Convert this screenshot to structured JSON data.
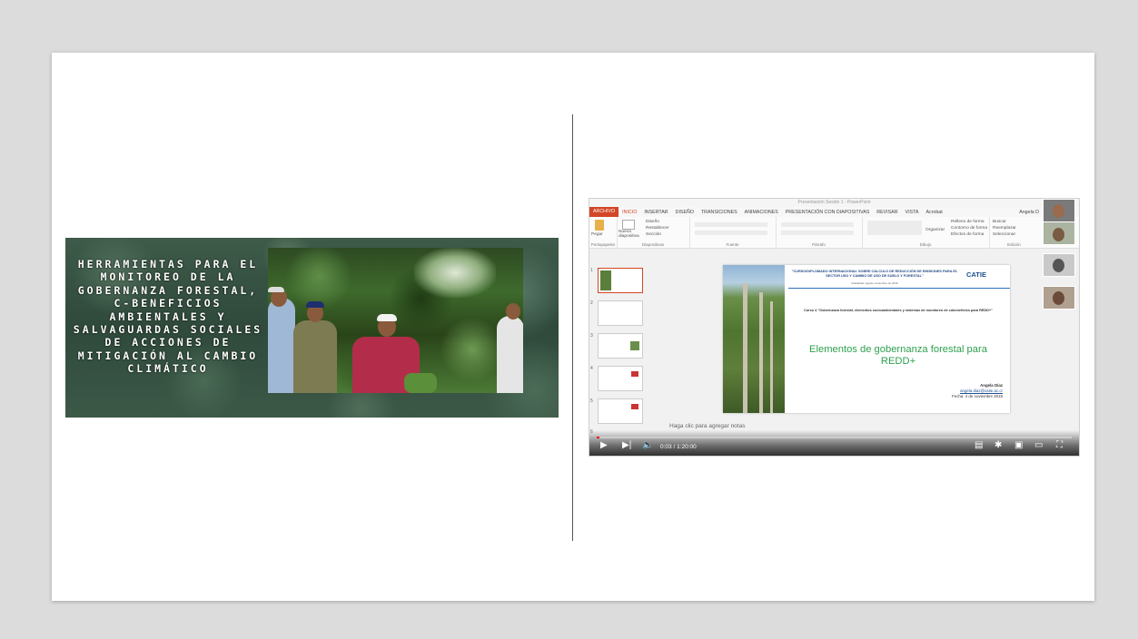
{
  "banner": {
    "text": "HERRAMIENTAS PARA EL MONITOREO DE LA GOBERNANZA FORESTAL, C-BENEFICIOS AMBIENTALES Y SALVAGUARDAS SOCIALES DE ACCIONES DE MITIGACIÓN AL CAMBIO CLIMÁTICO"
  },
  "ppt": {
    "window_title": "Presentación Sesión 1 - PowerPoint",
    "tabs": [
      "ARCHIVO",
      "INICIO",
      "INSERTAR",
      "DISEÑO",
      "TRANSICIONES",
      "ANIMACIONES",
      "PRESENTACIÓN CON DIAPOSITIVAS",
      "REVISAR",
      "VISTA",
      "Acrobat"
    ],
    "user": "Angela D",
    "ribbon": {
      "paste": "Pegar",
      "new_slide": "Nueva diapositiva",
      "layout": "Diseño",
      "reset": "Restablecer",
      "section": "Sección",
      "arrange": "Organizar",
      "quick_styles": "Estilos rápidos",
      "fill": "Relleno de forma",
      "outline": "Contorno de forma",
      "effects": "Efectos de forma",
      "find": "Buscar",
      "replace": "Reemplazar",
      "select": "Seleccionar",
      "group_clipboard": "Portapapeles",
      "group_slides": "Diapositivas",
      "group_font": "Fuente",
      "group_paragraph": "Párrafo",
      "group_drawing": "Dibujo",
      "group_editing": "Edición"
    },
    "thumb_numbers": [
      "1",
      "2",
      "3",
      "4",
      "5",
      "6"
    ],
    "slide": {
      "header": "\"CURSO/DIPLOMADO INTERNACIONAL SOBRE CÁLCULO DE REDUCCIÓN DE EMISIONES PARA EL SECTOR USO Y CAMBIO DE USO DE SUELO Y FORESTAL\"",
      "subheader": "Modalidad: agosto-noviembre de 2019",
      "logo": "CATIE",
      "curso": "Curso 4 \"Gobernanza forestal, elementos socioambientales y sistemas de monitoreo de cobeneficios para REDD+\"",
      "title": "Elementos de gobernanza forestal para REDD+",
      "author": "Angela Díaz",
      "email": "angela.diaz@catie.ac.cr",
      "date": "Fecha: 4 de noviembre 2019"
    },
    "notes_placeholder": "Haga clic para agregar notas"
  },
  "player": {
    "time": "0:03 / 1:20:00",
    "progress": 0.004
  }
}
